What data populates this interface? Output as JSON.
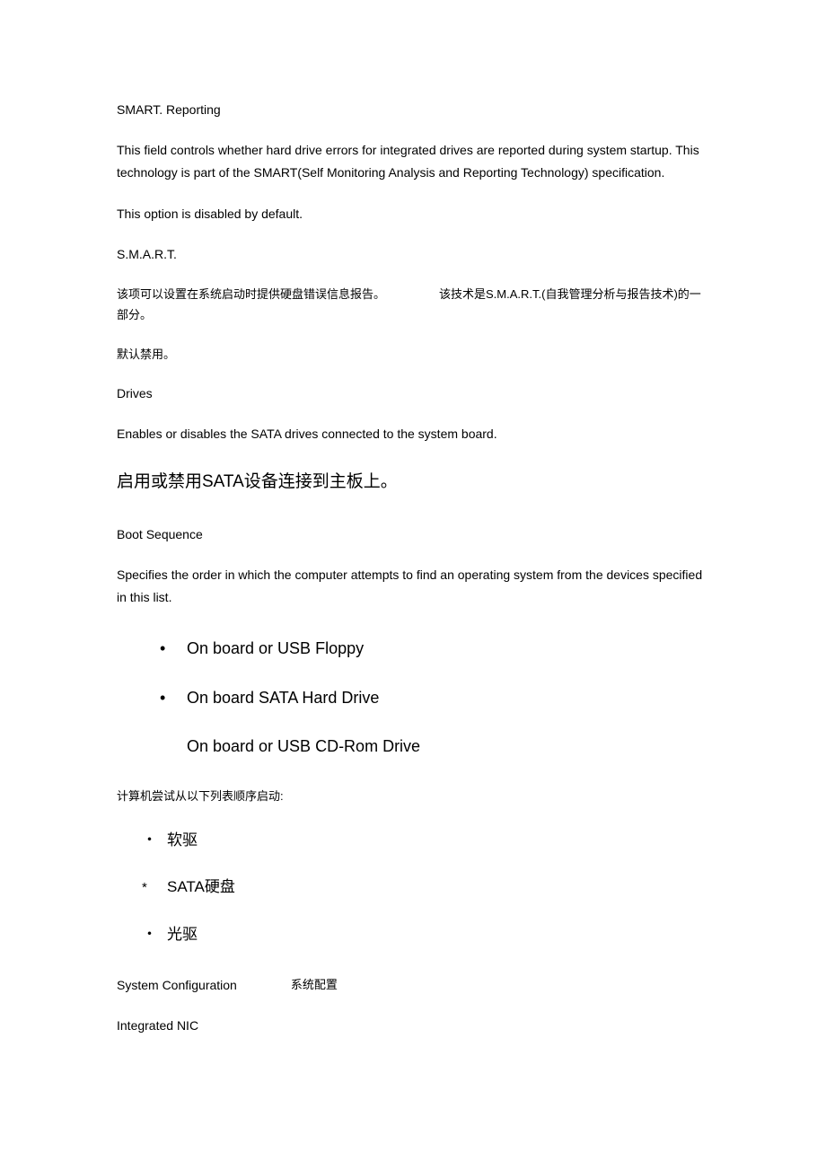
{
  "smart": {
    "title": "SMART. Reporting",
    "desc": "This field controls whether hard drive errors for integrated drives are reported during system startup. This technology is part of the SMART(Self Monitoring Analysis and Reporting Technology) specification.",
    "default_note": "This option is disabled by default.",
    "abbr": "S.M.A.R.T.",
    "cn_desc_part1": "该项可以设置在系统启动时提供硬盘错误信息报告。",
    "cn_desc_part2": "该技术是S.M.A.R.T.(自我管理分析与报告技术)的一部分。",
    "cn_default": "默认禁用。"
  },
  "drives": {
    "title": "Drives",
    "desc": "Enables or disables the SATA drives connected to the system board.",
    "cn_desc": "启用或禁用SATA设备连接到主板上。"
  },
  "boot": {
    "title": "Boot Sequence",
    "desc": "Specifies the order in which the computer attempts to find an operating system from the devices specified in this list.",
    "items": [
      "On board or USB Floppy",
      "On board SATA Hard Drive",
      "On board or USB CD-Rom Drive"
    ],
    "cn_lead": "计算机尝试从以下列表顺序启动:",
    "cn_items": [
      "软驱",
      "SATA硬盘",
      "光驱"
    ]
  },
  "sysconf": {
    "title_en": "System Configuration",
    "title_cn": "系统配置",
    "nic": "Integrated NIC"
  }
}
